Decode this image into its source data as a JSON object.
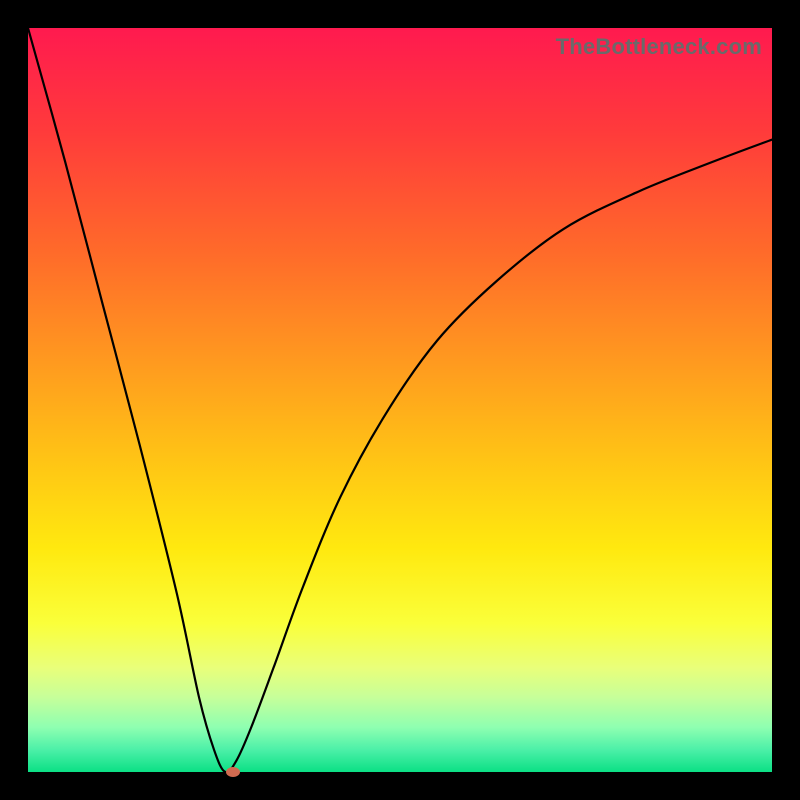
{
  "watermark": "TheBottleneck.com",
  "colors": {
    "frame": "#000000",
    "curve": "#000000",
    "marker": "#d16a50"
  },
  "chart_data": {
    "type": "line",
    "title": "",
    "xlabel": "",
    "ylabel": "",
    "xlim": [
      0,
      100
    ],
    "ylim": [
      0,
      100
    ],
    "grid": false,
    "legend": false,
    "series": [
      {
        "name": "bottleneck-curve",
        "x": [
          0,
          5,
          10,
          15,
          20,
          23,
          25,
          26.5,
          28,
          30,
          33,
          37,
          42,
          48,
          55,
          63,
          72,
          82,
          92,
          100
        ],
        "y": [
          100,
          82,
          63,
          44,
          24,
          10,
          3,
          0,
          1.5,
          6,
          14,
          25,
          37,
          48,
          58,
          66,
          73,
          78,
          82,
          85
        ]
      }
    ],
    "marker": {
      "x": 27.5,
      "y": 0
    },
    "gradient_stops": [
      {
        "pos": 0.0,
        "color": "#ff1a4f"
      },
      {
        "pos": 0.14,
        "color": "#ff3b3b"
      },
      {
        "pos": 0.3,
        "color": "#ff6a2a"
      },
      {
        "pos": 0.45,
        "color": "#ff9a1f"
      },
      {
        "pos": 0.58,
        "color": "#ffc415"
      },
      {
        "pos": 0.7,
        "color": "#ffe90f"
      },
      {
        "pos": 0.8,
        "color": "#faff3a"
      },
      {
        "pos": 0.86,
        "color": "#e9ff7a"
      },
      {
        "pos": 0.9,
        "color": "#c6ff9a"
      },
      {
        "pos": 0.94,
        "color": "#8effb1"
      },
      {
        "pos": 0.97,
        "color": "#4cf0a8"
      },
      {
        "pos": 1.0,
        "color": "#0be085"
      }
    ]
  }
}
